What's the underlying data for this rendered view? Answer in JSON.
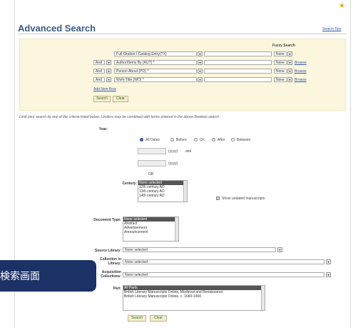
{
  "header": {
    "title": "Advanced Search",
    "search_tips": "Search Tips"
  },
  "query_builder": {
    "fuzzy_label": "Fuzzy Search",
    "rows": [
      {
        "bool": "",
        "field": "Full Citation / Catalog Entry(TX)",
        "fuzzy": "None",
        "browse": ""
      },
      {
        "bool": "And",
        "field": "Author/Items By (AUT) *",
        "fuzzy": "None",
        "browse": "Browse"
      },
      {
        "bool": "And",
        "field": "Person About (PO) *",
        "fuzzy": "None",
        "browse": "Browse"
      },
      {
        "bool": "And",
        "field": "Work Title (WO) *",
        "fuzzy": "None",
        "browse": "Browse"
      }
    ],
    "add_row": "Add New Row",
    "search": "Search",
    "clear": "Clear"
  },
  "limit_hint": "Limit your search by any of the criteria listed below. Limiters may be combined with terms entered in the above Boolean search.",
  "year": {
    "label": "Year:",
    "options": [
      "All Dates",
      "Before",
      "On",
      "After",
      "Between"
    ],
    "selected": "All Dates",
    "yyyy1": "(yyyy)",
    "and": "and",
    "yyyy2": "(yyyy)",
    "or": "OR"
  },
  "century": {
    "label": "Century:",
    "options": [
      "None selected",
      "12th century AD",
      "13th century AD",
      "14th century AD"
    ],
    "show_undated": "Show undated manuscripts"
  },
  "document_type": {
    "label": "Document Type:",
    "options": [
      "None selected",
      "Abstract",
      "Advertisement",
      "Announcement"
    ]
  },
  "source_library": {
    "label": "Source Library:",
    "value": "None selected"
  },
  "collection_in_library": {
    "label_line1": "Collection in",
    "label_line2": "Library:",
    "value": "None selected"
  },
  "acquisition_collections": {
    "label_line1": "Acquisition",
    "label_line2": "Collections:",
    "value": "None selected"
  },
  "part": {
    "label": "Part:",
    "options": [
      "All Parts",
      "British Literary Manuscripts Online, Medieval and Renaissance",
      "British Literary Manuscripts Online, c. 1660-1900"
    ]
  },
  "bottom_buttons": {
    "search": "Search",
    "clear": "Clear"
  },
  "overlay_caption": "検索画面",
  "colors": {
    "title": "#3d5a80",
    "panel_bg": "#fbf6dd",
    "overlay_bg": "#1c3266",
    "link": "#2e5aa8"
  }
}
